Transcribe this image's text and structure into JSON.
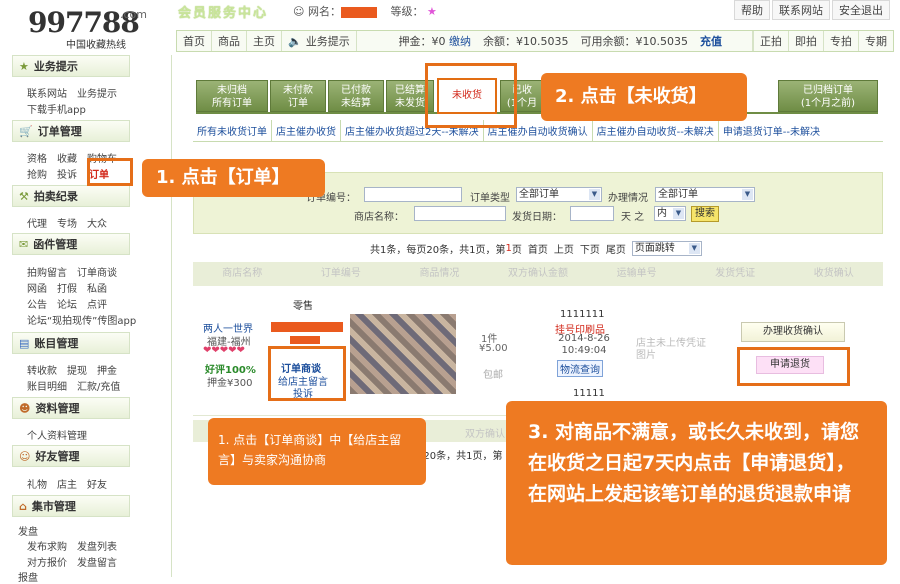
{
  "header": {
    "logo_number": "997788",
    "logo_domain": ".com",
    "logo_subtitle": "中国收藏热线",
    "member_center": "会员服务中心",
    "nickname_label": "网名：",
    "grade_label": "等级：",
    "grade_star": "★",
    "top_links": [
      "帮助",
      "联系网站",
      "安全退出"
    ]
  },
  "navbar": {
    "left": [
      "首页",
      "商品",
      "主页"
    ],
    "notify": "业务提示",
    "deposit": "押金：¥0",
    "deposit_link": "缴纳",
    "balance": "余额：¥10.5035",
    "available": "可用余额：¥10.5035",
    "recharge": "充值",
    "right": [
      "正拍",
      "即拍",
      "专拍",
      "专期"
    ]
  },
  "sidebar": {
    "sections": [
      {
        "title": "业务提示",
        "icon": "star-icon",
        "lines": [
          [
            "联系网站",
            "业务提示"
          ],
          [
            "下载手机app"
          ]
        ]
      },
      {
        "title": "订单管理",
        "icon": "cart-icon",
        "lines": [
          [
            "资格",
            "收藏",
            "购物车"
          ],
          [
            "抢购",
            "投诉",
            "订单"
          ]
        ]
      },
      {
        "title": "拍卖纪录",
        "icon": "gavel-icon",
        "lines": [
          [
            "代理",
            "专场",
            "大众"
          ]
        ]
      },
      {
        "title": "函件管理",
        "icon": "mail-icon",
        "lines": [
          [
            "拍购留言",
            "订单商谈"
          ],
          [
            "网函",
            "打假",
            "私函"
          ],
          [
            "公告",
            "论坛",
            "点评"
          ],
          [
            "论坛“现拍现传”传图app"
          ]
        ]
      },
      {
        "title": "账目管理",
        "icon": "ledger-icon",
        "lines": [
          [
            "转收款",
            "提现",
            "押金"
          ],
          [
            "账目明细",
            "汇款/充值"
          ]
        ]
      },
      {
        "title": "资料管理",
        "icon": "person-icon",
        "lines": [
          [
            "个人资料管理"
          ]
        ]
      },
      {
        "title": "好友管理",
        "icon": "friends-icon",
        "lines": [
          [
            "礼物",
            "店主",
            "好友"
          ]
        ]
      },
      {
        "title": "集市管理",
        "icon": "market-icon",
        "lines": [
          [
            "发盘"
          ],
          [
            "发布求购",
            "发盘列表"
          ],
          [
            "对方报价",
            "发盘留言"
          ],
          [
            "报盘"
          ]
        ]
      }
    ]
  },
  "tabs": {
    "items": [
      {
        "l1": "未归档",
        "l2": "所有订单"
      },
      {
        "l1": "未付款",
        "l2": "订单"
      },
      {
        "l1": "已付款",
        "l2": "未结算"
      },
      {
        "l1": "已结算",
        "l2": "未发货"
      },
      {
        "l1": "已收",
        "l2": "(1个月"
      },
      {
        "l1": "已归档订单",
        "l2": "(1个月之前)"
      }
    ],
    "active": "未收货"
  },
  "subtabs": [
    "所有未收货订单",
    "店主催办收货",
    "店主催办收货超过2天--未解决",
    "店主催办自动收货确认",
    "店主催办自动收货--未解决",
    "申请退货订单--未解决"
  ],
  "search": {
    "order_no": "订单编号：",
    "order_type": "订单类型",
    "order_type_value": "全部订单",
    "status": "办理情况",
    "status_value": "全部订单",
    "shop_name": "商店名称：",
    "ship_date": "发货日期：",
    "days": "天 之",
    "within": "内",
    "search_btn": "搜索"
  },
  "pager": {
    "a": "共1条，每页20条，共1页，第",
    "cur": "1",
    "b": "页",
    "links": [
      "首页",
      "上页",
      "下页",
      "尾页"
    ],
    "jump": "页面跳转"
  },
  "table": {
    "headers": [
      "商店名称",
      "订单编号",
      "商品情况",
      "双方确认金额",
      "运输单号",
      "发货凭证",
      "收货确认"
    ]
  },
  "row": {
    "shop_l1": "两人一世界",
    "shop_l2": "福建-福州",
    "hearts": "❤❤❤❤❤",
    "rating": "好评100%",
    "deposit": "押金¥300",
    "type": "零售",
    "op1": "订单商谈",
    "op2": "给店主留言",
    "op3": "投诉",
    "qty": "1件",
    "price": "¥5.00",
    "shipping": "包邮",
    "tracking_no": "1111111",
    "mail_type": "挂号印刷品",
    "ship_time": "2014-8-26 10:49:04",
    "logistics": "物流查询",
    "tracking_no2": "11111",
    "no_proof": "店主未上传凭证图片",
    "confirm_btn": "办理收货确认",
    "refund_btn": "申请退货"
  },
  "footer_pager": "共1条，每页20条，共1页，第",
  "footer_col": "双方确认",
  "callouts": {
    "c1": "1. 点击【订单】",
    "c2": "2. 点击【未收货】",
    "c3": "1. 点击【订单商谈】中【给店主留言】与卖家沟通协商",
    "c4": "3. 对商品不满意，或长久未收到，请您在收货之日起7天内点击【申请退货】，在网站上发起该笔订单的退货退款申请"
  },
  "colors": {
    "accent": "#ee7a22",
    "tab_green": "#7d9a52",
    "link": "#1d4f9c",
    "red": "#d2281a"
  }
}
